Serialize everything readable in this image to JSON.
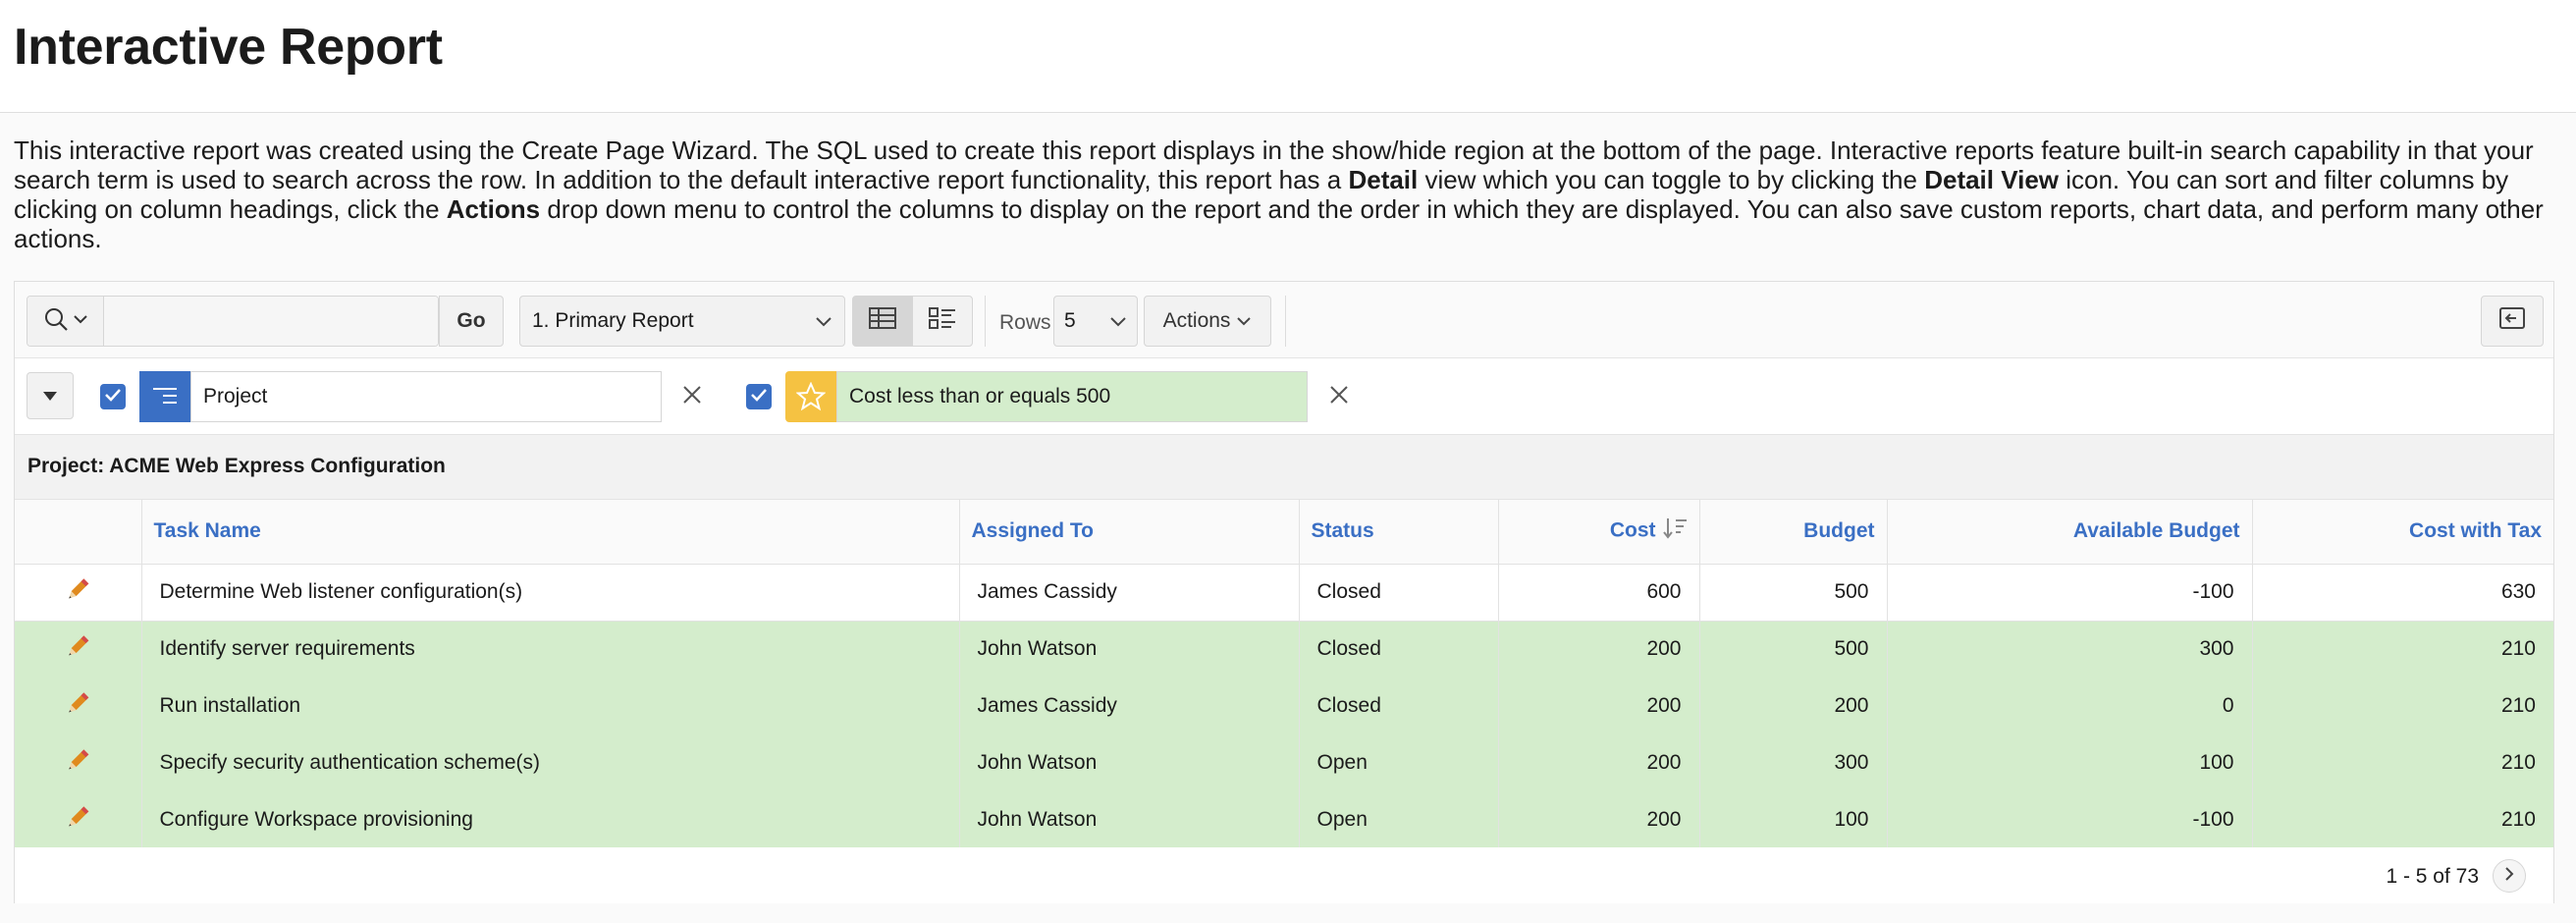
{
  "page": {
    "title": "Interactive Report",
    "description_parts": {
      "p1": "This interactive report was created using the Create Page Wizard. The SQL used to create this report displays in the show/hide region at the bottom of the page. Interactive reports feature built-in search capability in that your search term is used to search across the row. In addition to the default interactive report functionality, this report has a ",
      "b1": "Detail",
      "p2": " view which you can toggle to by clicking the ",
      "b2": "Detail View",
      "p3": " icon. You can sort and filter columns by clicking on column headings, click the ",
      "b3": "Actions",
      "p4": " drop down menu to control the columns to display on the report and the order in which they are displayed. You can also save custom reports, chart data, and perform many other actions."
    }
  },
  "toolbar": {
    "search_value": "",
    "search_placeholder": "",
    "go_label": "Go",
    "report_selected": "1. Primary Report",
    "rows_label": "Rows",
    "rows_value": "5",
    "actions_label": "Actions"
  },
  "filters": {
    "group_by": {
      "label": "Project",
      "checked": true
    },
    "highlight": {
      "label": "Cost less than or equals 500",
      "checked": true,
      "color": "#d4edcc",
      "icon_color": "#f5c242"
    }
  },
  "group": {
    "label": "Project: ACME Web Express Configuration"
  },
  "table": {
    "columns": {
      "task_name": "Task Name",
      "assigned_to": "Assigned To",
      "status": "Status",
      "cost": "Cost",
      "budget": "Budget",
      "available_budget": "Available Budget",
      "cost_with_tax": "Cost with Tax"
    },
    "rows": [
      {
        "task": "Determine Web listener configuration(s)",
        "assigned": "James Cassidy",
        "status": "Closed",
        "cost": "600",
        "budget": "500",
        "available": "-100",
        "tax": "630",
        "highlighted": false
      },
      {
        "task": "Identify server requirements",
        "assigned": "John Watson",
        "status": "Closed",
        "cost": "200",
        "budget": "500",
        "available": "300",
        "tax": "210",
        "highlighted": true
      },
      {
        "task": "Run installation",
        "assigned": "James Cassidy",
        "status": "Closed",
        "cost": "200",
        "budget": "200",
        "available": "0",
        "tax": "210",
        "highlighted": true
      },
      {
        "task": "Specify security authentication scheme(s)",
        "assigned": "John Watson",
        "status": "Open",
        "cost": "200",
        "budget": "300",
        "available": "100",
        "tax": "210",
        "highlighted": true
      },
      {
        "task": "Configure Workspace provisioning",
        "assigned": "John Watson",
        "status": "Open",
        "cost": "200",
        "budget": "100",
        "available": "-100",
        "tax": "210",
        "highlighted": true
      }
    ]
  },
  "pagination": {
    "label": "1 - 5 of 73"
  },
  "colors": {
    "accent": "#3a6fc4",
    "highlight": "#d4edcc",
    "star": "#f5c242",
    "pencil": "#e08a1e"
  }
}
